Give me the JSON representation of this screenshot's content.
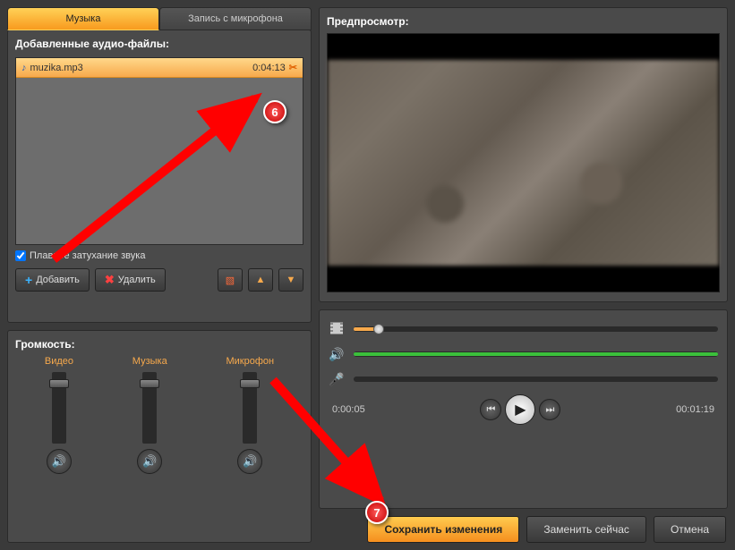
{
  "tabs": {
    "music": "Музыка",
    "mic": "Запись с микрофона"
  },
  "added_files_title": "Добавленные аудио-файлы:",
  "file": {
    "name": "muzika.mp3",
    "duration": "0:04:13"
  },
  "fade_checkbox": "Плавное затухание звука",
  "buttons": {
    "add": "Добавить",
    "delete": "Удалить"
  },
  "volume": {
    "title": "Громкость:",
    "video": "Видео",
    "music": "Музыка",
    "mic": "Микрофон"
  },
  "preview_title": "Предпросмотр:",
  "time": {
    "current": "0:00:05",
    "total": "00:01:19"
  },
  "bottom": {
    "save": "Сохранить изменения",
    "replace": "Заменить сейчас",
    "cancel": "Отмена"
  },
  "anno": {
    "six": "6",
    "seven": "7"
  }
}
